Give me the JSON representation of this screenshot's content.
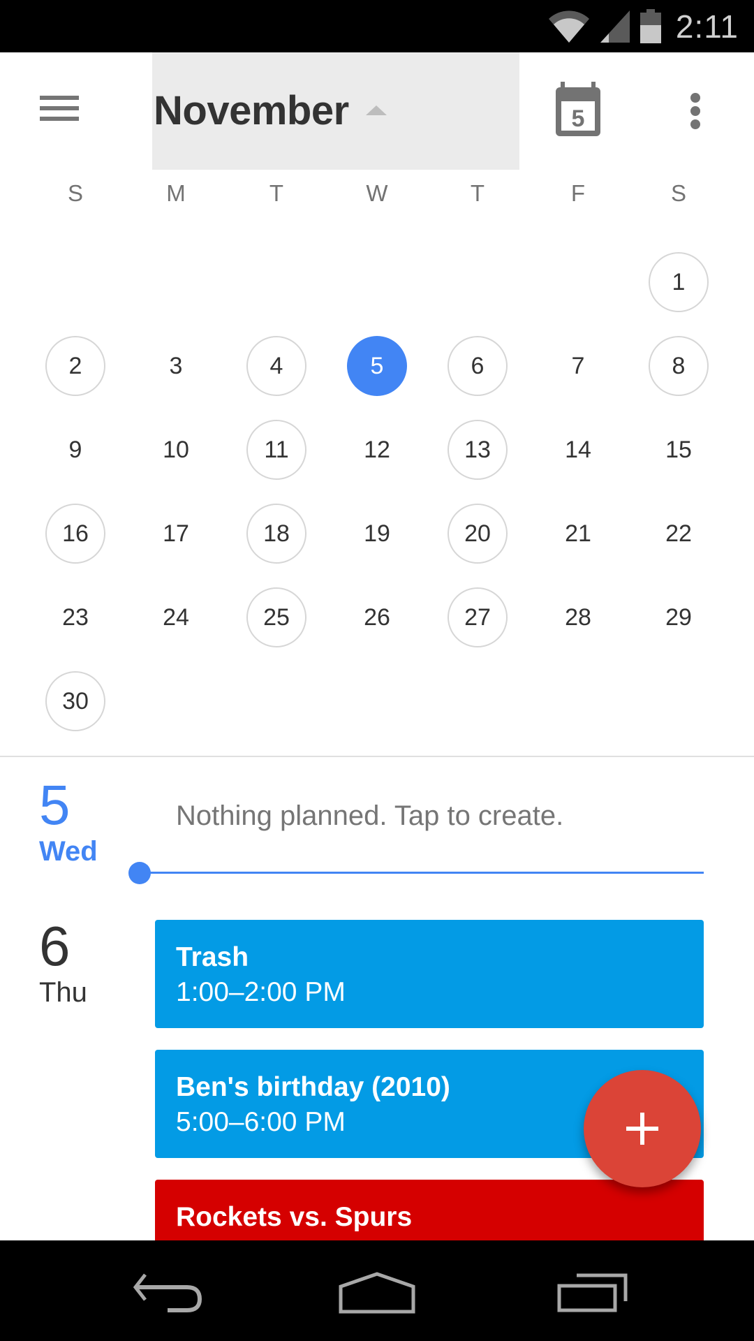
{
  "status_bar": {
    "time": "2:11",
    "icons": [
      "wifi-icon",
      "cellular-signal-icon",
      "battery-icon"
    ]
  },
  "header": {
    "menu_icon": "hamburger-menu-icon",
    "month_label": "November",
    "month_toggle_icon": "caret-up-icon",
    "today_icon": "calendar-today-icon",
    "today_icon_day": "5",
    "overflow_icon": "more-vertical-icon"
  },
  "calendar": {
    "weekdays": [
      "S",
      "M",
      "T",
      "W",
      "T",
      "F",
      "S"
    ],
    "first_weekday_index": 6,
    "days_in_month": 30,
    "selected_day": 5,
    "days_with_events": [
      1,
      2,
      4,
      6,
      8,
      11,
      13,
      16,
      18,
      20,
      25,
      27,
      30
    ],
    "accent_color": "#4285f4",
    "event_ring_color": "#d6d6d6"
  },
  "agenda": {
    "days": [
      {
        "date": "5",
        "weekday": "Wed",
        "is_today": true,
        "empty_message": "Nothing planned. Tap to create.",
        "events": []
      },
      {
        "date": "6",
        "weekday": "Thu",
        "is_today": false,
        "events": [
          {
            "title": "Trash",
            "time": "1:00–2:00 PM",
            "color": "#039be5"
          },
          {
            "title": "Ben's birthday (2010)",
            "time": "5:00–6:00 PM",
            "color": "#039be5"
          },
          {
            "title": "Rockets vs. Spurs",
            "time": "",
            "color": "#d50000"
          }
        ]
      }
    ]
  },
  "fab": {
    "icon": "plus-icon",
    "color": "#db4437"
  },
  "nav_bar": {
    "buttons": [
      "back-icon",
      "home-icon",
      "recent-apps-icon"
    ]
  }
}
